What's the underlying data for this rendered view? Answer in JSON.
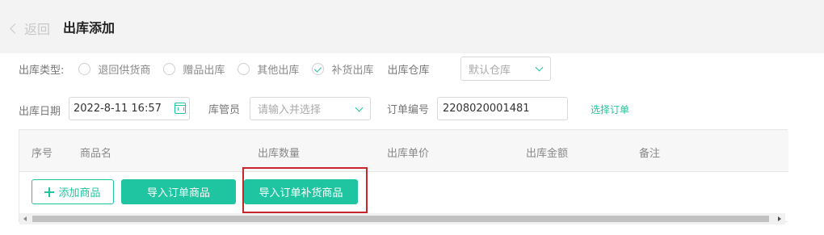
{
  "header": {
    "back_label": "返回",
    "title": "出库添加"
  },
  "outbound_type": {
    "label": "出库类型:",
    "options": [
      {
        "label": "退回供货商",
        "selected": false
      },
      {
        "label": "赠品出库",
        "selected": false
      },
      {
        "label": "其他出库",
        "selected": false
      },
      {
        "label": "补货出库",
        "selected": true
      }
    ]
  },
  "warehouse": {
    "label": "出库仓库",
    "value": "默认仓库"
  },
  "outbound_date": {
    "label": "出库日期",
    "value": "2022-8-11 16:57"
  },
  "keeper": {
    "label": "库管员",
    "placeholder": "请输入并选择"
  },
  "order_no": {
    "label": "订单编号",
    "value": "2208020001481",
    "select_link": "选择订单"
  },
  "table": {
    "columns": [
      "序号",
      "商品名",
      "出库数量",
      "出库单价",
      "出库金额",
      "备注"
    ]
  },
  "actions": {
    "add_product": "添加商品",
    "import_order_products": "导入订单商品",
    "import_order_replenish_products": "导入订单补货商品"
  },
  "colors": {
    "accent": "#1fc5a0",
    "highlight": "#c8252c"
  }
}
